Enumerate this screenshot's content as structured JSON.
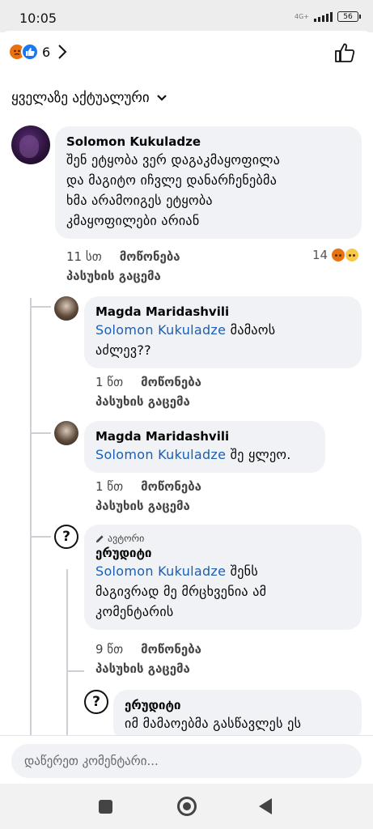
{
  "status_bar": {
    "time": "10:05",
    "network": "4G+",
    "battery": "56"
  },
  "header": {
    "reaction_count": "6"
  },
  "sort": {
    "label": "ყველაზე აქტუალური"
  },
  "comments": [
    {
      "author": "Solomon  Kukuladze",
      "lines": [
        "შენ ეტყობა ვერ დაგაკმაყოფილა",
        "და მაგიტო იჩვლე დანარჩენებმა",
        "ხმა არამოიგეს ეტყობა",
        "კმაყოფილები არიან"
      ],
      "time": "11 სთ",
      "like": "მოწონება",
      "reply": "პასუხის გაცემა",
      "reaction_count": "14"
    },
    {
      "author": "Magda Maridashvili",
      "mention": "Solomon  Kukuladze",
      "lines": [
        " მამაოს",
        "აძლევ??"
      ],
      "time": "1 წთ",
      "like": "მოწონება",
      "reply": "პასუხის გაცემა"
    },
    {
      "author": "Magda Maridashvili",
      "mention": "Solomon  Kukuladze",
      "lines": [
        " შე ყლეო."
      ],
      "time": "1 წთ",
      "like": "მოწონება",
      "reply": "პასუხის გაცემა"
    },
    {
      "badge": "ავტორი",
      "author": "ერუდიტი",
      "mention": "Solomon  Kukuladze",
      "lines": [
        " შენს",
        "მაგივრად მე მრცხვენია ამ",
        "კომენტარის"
      ],
      "time": "9 წთ",
      "like": "მოწონება",
      "reply": "პასუხის გაცემა"
    },
    {
      "author": "ერუდიტი",
      "lines": [
        "იმ მამაოებმა გასწავლეს ეს"
      ]
    }
  ],
  "composer": {
    "placeholder": "დაწერეთ კომენტარი..."
  },
  "colors": {
    "mention": "#1a5fb4",
    "bubble": "#f0f2f5",
    "like_blue": "#1877f2",
    "angry_orange": "#e9710f"
  }
}
